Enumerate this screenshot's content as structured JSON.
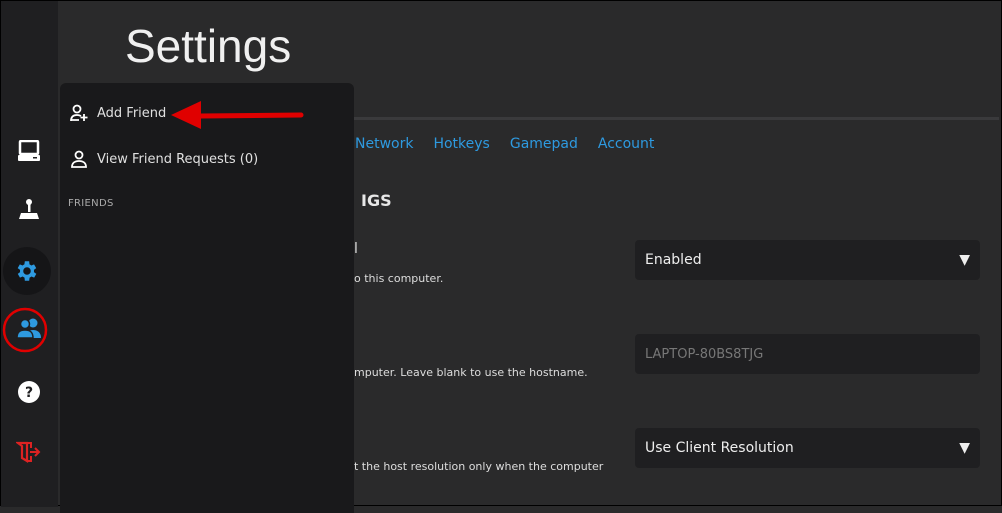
{
  "header": {
    "title": "Settings"
  },
  "tabs": [
    {
      "label": "Network"
    },
    {
      "label": "Hotkeys"
    },
    {
      "label": "Gamepad"
    },
    {
      "label": "Account"
    }
  ],
  "section": {
    "title": "IGS"
  },
  "settings": [
    {
      "label": "l",
      "description": "o this computer.",
      "value": "Enabled",
      "type": "select"
    },
    {
      "description": "mputer. Leave blank to use the hostname.",
      "placeholder": "LAPTOP-80BS8TJG",
      "type": "input"
    },
    {
      "description": "t the host resolution only when the computer",
      "value": "Use Client Resolution",
      "type": "select"
    }
  ],
  "sidebar": {
    "items": [
      {
        "icon": "computer-icon"
      },
      {
        "icon": "joystick-icon"
      },
      {
        "icon": "gear-icon",
        "active": true
      },
      {
        "icon": "friends-icon"
      },
      {
        "icon": "help-icon"
      },
      {
        "icon": "logout-icon"
      }
    ]
  },
  "friends_panel": {
    "add_friend": "Add Friend",
    "view_requests": "View Friend Requests (0)",
    "friends_heading": "FRIENDS"
  },
  "colors": {
    "accent": "#2e9ae0",
    "annotation": "#e00000",
    "logout": "#d22"
  }
}
